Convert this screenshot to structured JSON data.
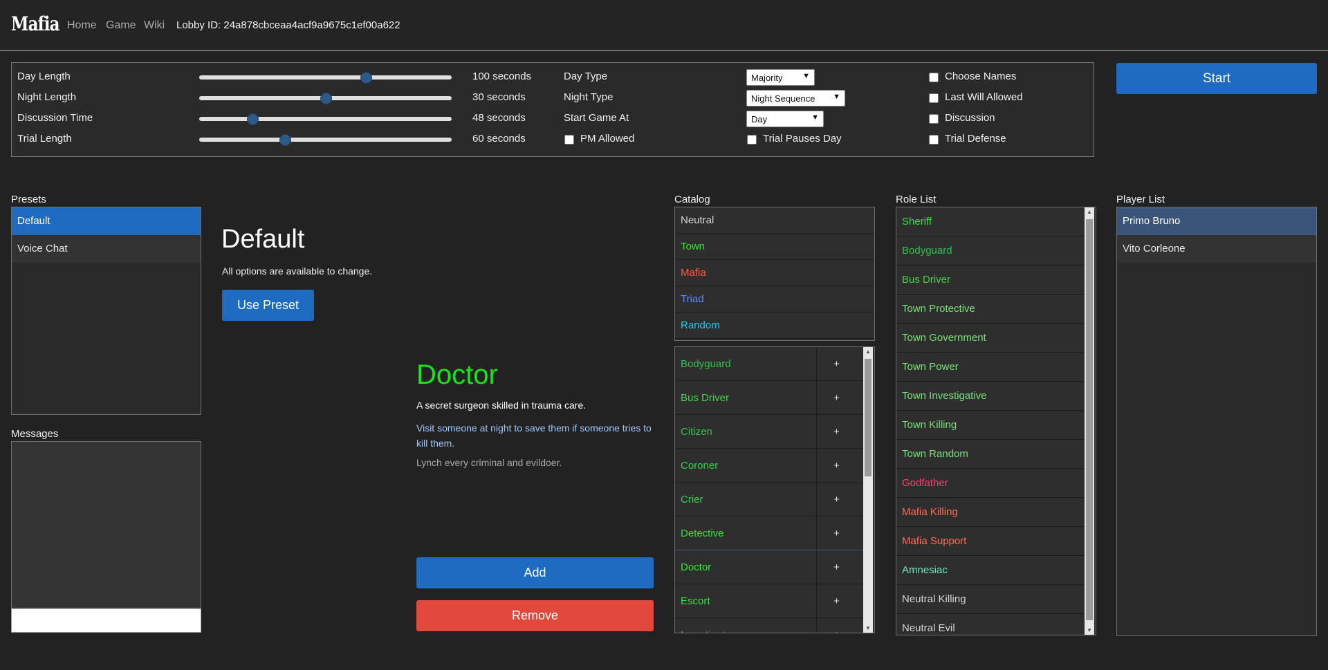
{
  "header": {
    "logo": "Mafia",
    "nav": [
      "Home",
      "Game",
      "Wiki"
    ],
    "lobby": "Lobby ID: 24a878cbceaa4acf9a9675c1ef00a622"
  },
  "settings": {
    "sliders": [
      {
        "label": "Day Length",
        "value": "100 seconds",
        "level": 0.66
      },
      {
        "label": "Night Length",
        "value": "30 seconds",
        "level": 0.5
      },
      {
        "label": "Discussion Time",
        "value": "48 seconds",
        "level": 0.21
      },
      {
        "label": "Trial Length",
        "value": "60 seconds",
        "level": 0.34
      }
    ],
    "selects": [
      {
        "label": "Day Type",
        "value": "Majority"
      },
      {
        "label": "Night Type",
        "value": "Night Sequence"
      },
      {
        "label": "Start Game At",
        "value": "Day"
      }
    ],
    "checks": {
      "pm_allowed": "PM Allowed",
      "trial_pauses_day": "Trial Pauses Day",
      "choose_names": "Choose Names",
      "last_will": "Last Will Allowed",
      "discussion": "Discussion",
      "trial_defense": "Trial Defense"
    },
    "start_label": "Start"
  },
  "presets": {
    "title": "Presets",
    "items": [
      "Default",
      "Voice Chat"
    ],
    "detail_title": "Default",
    "detail_desc": "All options are available to change.",
    "use_label": "Use Preset"
  },
  "messages": {
    "title": "Messages"
  },
  "role": {
    "name": "Doctor",
    "summary": "A secret surgeon skilled in trauma care.",
    "ability": "Visit someone at night to save them if someone tries to kill them.",
    "goal": "Lynch every criminal and evildoer.",
    "add_label": "Add",
    "remove_label": "Remove",
    "color": "#19e619"
  },
  "catalog": {
    "title": "Catalog",
    "categories": [
      {
        "name": "Neutral",
        "color": "#d6d6d6"
      },
      {
        "name": "Town",
        "color": "#33e633"
      },
      {
        "name": "Mafia",
        "color": "#ff5a4a"
      },
      {
        "name": "Triad",
        "color": "#5a8cff"
      },
      {
        "name": "Random",
        "color": "#1ec8f0"
      }
    ],
    "roles": [
      {
        "name": "Bodyguard",
        "color": "#2fc44a"
      },
      {
        "name": "Bus Driver",
        "color": "#46d24a"
      },
      {
        "name": "Citizen",
        "color": "#2fc44a"
      },
      {
        "name": "Coroner",
        "color": "#2fd44a"
      },
      {
        "name": "Crier",
        "color": "#2fd44a"
      },
      {
        "name": "Detective",
        "color": "#33e633"
      },
      {
        "name": "Doctor",
        "color": "#33e633"
      },
      {
        "name": "Escort",
        "color": "#33e633"
      },
      {
        "name": "Investigator",
        "color": "#2fd44a"
      }
    ],
    "plus": "+"
  },
  "role_list": {
    "title": "Role List",
    "items": [
      {
        "name": "Sheriff",
        "color": "#33e633"
      },
      {
        "name": "Bodyguard",
        "color": "#2fc44a"
      },
      {
        "name": "Bus Driver",
        "color": "#46d24a"
      },
      {
        "name": "Town Protective",
        "color": "#7be07b"
      },
      {
        "name": "Town Government",
        "color": "#7be07b"
      },
      {
        "name": "Town Power",
        "color": "#7be07b"
      },
      {
        "name": "Town Investigative",
        "color": "#7be07b"
      },
      {
        "name": "Town Killing",
        "color": "#7be07b"
      },
      {
        "name": "Town Random",
        "color": "#7be07b"
      },
      {
        "name": "Godfather",
        "color": "#ff3d6e"
      },
      {
        "name": "Mafia Killing",
        "color": "#ff6b5a"
      },
      {
        "name": "Mafia Support",
        "color": "#ff6b5a"
      },
      {
        "name": "Amnesiac",
        "color": "#6fe7c0"
      },
      {
        "name": "Neutral Killing",
        "color": "#d6d6d6"
      },
      {
        "name": "Neutral Evil",
        "color": "#d6d6d6"
      }
    ]
  },
  "player_list": {
    "title": "Player List",
    "items": [
      "Primo Bruno",
      "Vito Corleone"
    ]
  }
}
